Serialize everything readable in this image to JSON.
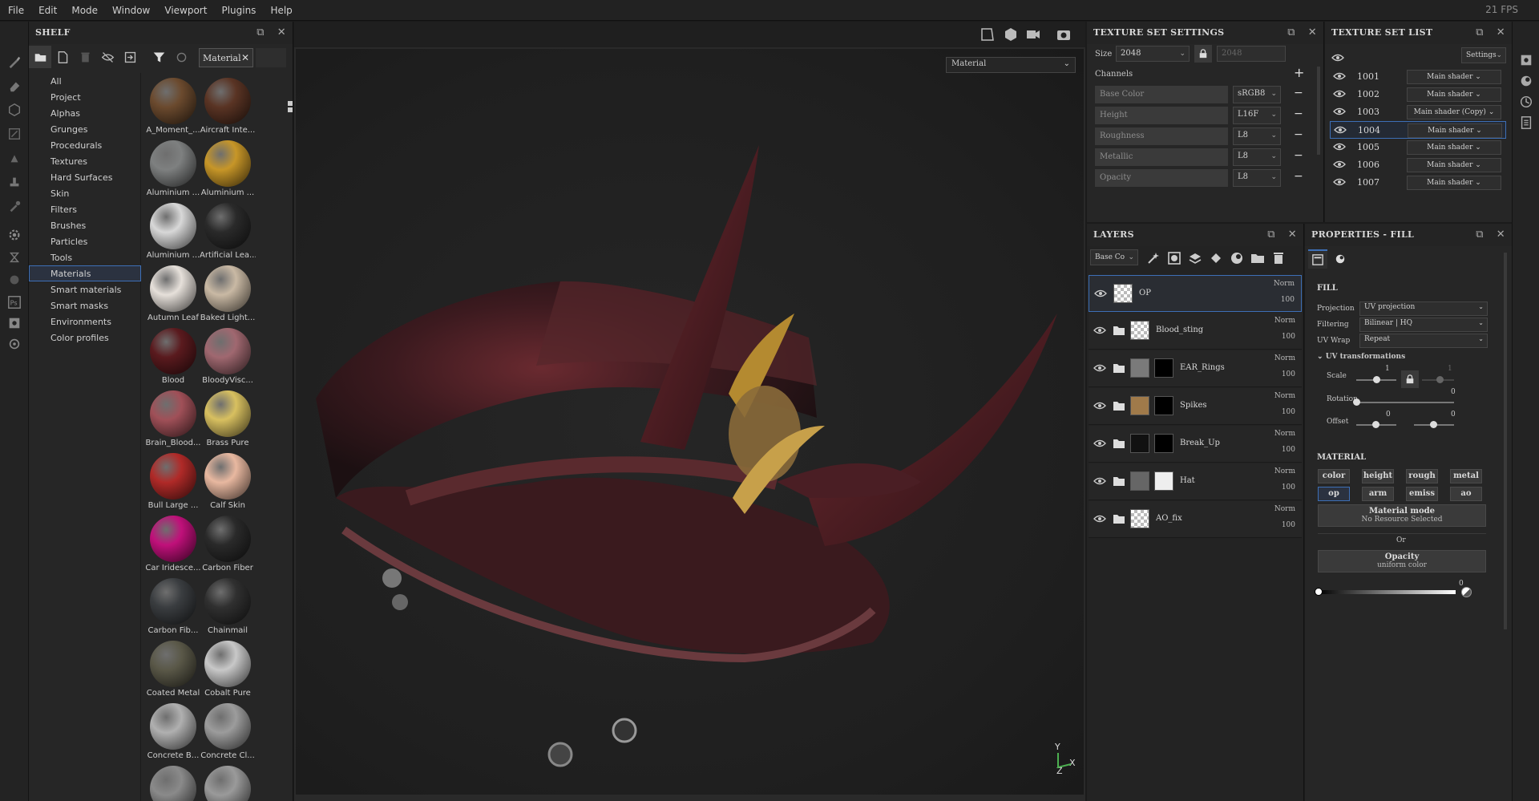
{
  "menubar": {
    "items": [
      "File",
      "Edit",
      "Mode",
      "Window",
      "Viewport",
      "Plugins",
      "Help"
    ],
    "fps": "21 FPS"
  },
  "shelf": {
    "title": "SHELF",
    "filter_tag": "Material",
    "categories": [
      "All",
      "Project",
      "Alphas",
      "Grunges",
      "Procedurals",
      "Textures",
      "Hard Surfaces",
      "Skin",
      "Filters",
      "Brushes",
      "Particles",
      "Tools",
      "Materials",
      "Smart materials",
      "Smart masks",
      "Environments",
      "Color profiles"
    ],
    "selected_category": "Materials",
    "materials": [
      {
        "label": "A_Moment_...",
        "color": "#6b4a2e"
      },
      {
        "label": "Aircraft Inte...",
        "color": "#5a3424"
      },
      {
        "label": "Aluminium ...",
        "color": "#7e8080"
      },
      {
        "label": "Aluminium ...",
        "color": "#c79628"
      },
      {
        "label": "Aluminium ...",
        "color": "#d8d8d8"
      },
      {
        "label": "Artificial Lea...",
        "color": "#2a2a2a"
      },
      {
        "label": "Autumn Leaf",
        "color": "#e6e0da"
      },
      {
        "label": "Baked Light...",
        "color": "#c9b9a4"
      },
      {
        "label": "Blood",
        "color": "#5a1a1e"
      },
      {
        "label": "BloodyVisc...",
        "color": "#a06870"
      },
      {
        "label": "Brain_Blood...",
        "color": "#a05058"
      },
      {
        "label": "Brass Pure",
        "color": "#d8c060"
      },
      {
        "label": "Bull Large ...",
        "color": "#b02a28"
      },
      {
        "label": "Calf Skin",
        "color": "#e8b8a0"
      },
      {
        "label": "Car Iridesce...",
        "color": "#c0107a"
      },
      {
        "label": "Carbon Fiber",
        "color": "#2a2a2a"
      },
      {
        "label": "Carbon Fib...",
        "color": "#3a3d40"
      },
      {
        "label": "Chainmail",
        "color": "#303030"
      },
      {
        "label": "Coated Metal",
        "color": "#5a5848"
      },
      {
        "label": "Cobalt Pure",
        "color": "#c8c8c8"
      },
      {
        "label": "Concrete B...",
        "color": "#b0b0b0"
      },
      {
        "label": "Concrete Cl...",
        "color": "#9c9c9c"
      },
      {
        "label": "",
        "color": "#8a8a8a"
      },
      {
        "label": "",
        "color": "#9a9a9a"
      }
    ]
  },
  "viewport": {
    "display_mode": "Material",
    "axis_x": "X",
    "axis_y": "Y",
    "axis_z": "Z"
  },
  "texture_set_settings": {
    "title": "TEXTURE SET SETTINGS",
    "size_label": "Size",
    "size_value": "2048",
    "size_value_locked": "2048",
    "channels_label": "Channels",
    "channels": [
      {
        "name": "Base Color",
        "format": "sRGB8"
      },
      {
        "name": "Height",
        "format": "L16F"
      },
      {
        "name": "Roughness",
        "format": "L8"
      },
      {
        "name": "Metallic",
        "format": "L8"
      },
      {
        "name": "Opacity",
        "format": "L8"
      }
    ]
  },
  "texture_set_list": {
    "title": "TEXTURE SET LIST",
    "settings_label": "Settings",
    "sets": [
      {
        "name": "1001",
        "shader": "Main shader",
        "selected": false
      },
      {
        "name": "1002",
        "shader": "Main shader",
        "selected": false
      },
      {
        "name": "1003",
        "shader": "Main shader (Copy)",
        "selected": false
      },
      {
        "name": "1004",
        "shader": "Main shader",
        "selected": true
      },
      {
        "name": "1005",
        "shader": "Main shader",
        "selected": false
      },
      {
        "name": "1006",
        "shader": "Main shader",
        "selected": false
      },
      {
        "name": "1007",
        "shader": "Main shader",
        "selected": false
      }
    ]
  },
  "layers": {
    "title": "LAYERS",
    "channel_select": "Base Co",
    "items": [
      {
        "name": "OP",
        "blend": "Norm",
        "opacity": "100",
        "folder": false,
        "selected": true
      },
      {
        "name": "Blood_sting",
        "blend": "Norm",
        "opacity": "100",
        "folder": true,
        "selected": false
      },
      {
        "name": "EAR_Rings",
        "blend": "Norm",
        "opacity": "100",
        "folder": true,
        "selected": false
      },
      {
        "name": "Spikes",
        "blend": "Norm",
        "opacity": "100",
        "folder": true,
        "selected": false
      },
      {
        "name": "Break_Up",
        "blend": "Norm",
        "opacity": "100",
        "folder": true,
        "selected": false
      },
      {
        "name": "Hat",
        "blend": "Norm",
        "opacity": "100",
        "folder": true,
        "selected": false
      },
      {
        "name": "AO_fix",
        "blend": "Norm",
        "opacity": "100",
        "folder": true,
        "selected": false
      }
    ]
  },
  "properties": {
    "title": "PROPERTIES - FILL",
    "fill_label": "FILL",
    "projection_label": "Projection",
    "projection_value": "UV projection",
    "filtering_label": "Filtering",
    "filtering_value": "Bilinear | HQ",
    "uvwrap_label": "UV Wrap",
    "uvwrap_value": "Repeat",
    "uv_transformations_label": "UV transformations",
    "scale_label": "Scale",
    "scale_value": "1",
    "scale_value2": "1",
    "rotation_label": "Rotation",
    "rotation_value": "0",
    "offset_label": "Offset",
    "offset_x": "0",
    "offset_y": "0",
    "material_label": "MATERIAL",
    "material_channels": [
      "color",
      "height",
      "rough",
      "metal",
      "op",
      "arm",
      "emiss",
      "ao"
    ],
    "material_active": "op",
    "material_mode_label": "Material mode",
    "material_mode_value": "No Resource Selected",
    "or_label": "Or",
    "opacity_label": "Opacity",
    "opacity_sub": "uniform color",
    "opacity_value": "0"
  },
  "colors": {
    "accent": "#3d6fb6",
    "panel": "#262626",
    "background": "#1b1b1b"
  }
}
